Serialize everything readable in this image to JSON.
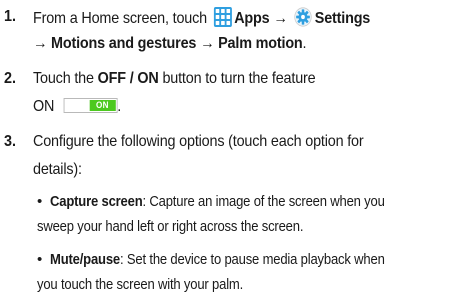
{
  "steps": [
    {
      "number": "1.",
      "text_before_apps": "From a Home screen, touch",
      "apps_label": "Apps",
      "arrow": "→",
      "settings_label": "Settings",
      "path_line": "→ Motions and gestures → Palm motion",
      "path_period": "."
    },
    {
      "number": "2.",
      "text_before": "Touch the",
      "button_name": "OFF / ON",
      "text_after": "button to turn the feature",
      "on_text": "ON",
      "toggle_label": "ON",
      "period": "."
    },
    {
      "number": "3.",
      "line1": "Configure the following options (touch each option for",
      "line2": "details):"
    }
  ],
  "options": [
    {
      "bullet": "•",
      "term": "Capture screen",
      "desc_line1": ": Capture an image of the screen when you",
      "desc_line2": "sweep your hand left or right across the screen."
    },
    {
      "bullet": "•",
      "term": "Mute/pause",
      "desc_line1": ": Set the device to pause media playback when",
      "desc_line2": "you touch the screen with your palm."
    }
  ],
  "icons": {
    "apps": "apps-grid-icon",
    "settings": "settings-gear-icon",
    "apps_color": "#2f9fe0",
    "settings_color": "#2f9fe0",
    "toggle_on_color": "#4cc91f"
  }
}
